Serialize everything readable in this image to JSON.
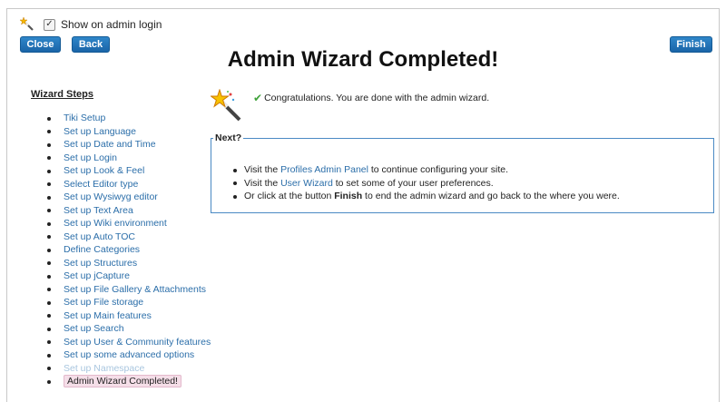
{
  "header": {
    "show_on_login_label": "Show on admin login",
    "show_on_login_checked": true,
    "close_label": "Close",
    "back_label": "Back",
    "finish_label": "Finish",
    "title": "Admin Wizard Completed!"
  },
  "sidebar": {
    "heading": "Wizard Steps",
    "items": [
      {
        "label": "Tiki Setup",
        "state": "link"
      },
      {
        "label": "Set up Language",
        "state": "link"
      },
      {
        "label": "Set up Date and Time",
        "state": "link"
      },
      {
        "label": "Set up Login",
        "state": "link"
      },
      {
        "label": "Set up Look & Feel",
        "state": "link"
      },
      {
        "label": "Select Editor type",
        "state": "link"
      },
      {
        "label": "Set up Wysiwyg editor",
        "state": "link"
      },
      {
        "label": "Set up Text Area",
        "state": "link"
      },
      {
        "label": "Set up Wiki environment",
        "state": "link"
      },
      {
        "label": "Set up Auto TOC",
        "state": "link"
      },
      {
        "label": "Define Categories",
        "state": "link"
      },
      {
        "label": "Set up Structures",
        "state": "link"
      },
      {
        "label": "Set up jCapture",
        "state": "link"
      },
      {
        "label": "Set up File Gallery & Attachments",
        "state": "link"
      },
      {
        "label": "Set up File storage",
        "state": "link"
      },
      {
        "label": "Set up Main features",
        "state": "link"
      },
      {
        "label": "Set up Search",
        "state": "link"
      },
      {
        "label": "Set up User & Community features",
        "state": "link"
      },
      {
        "label": "Set up some advanced options",
        "state": "link"
      },
      {
        "label": "Set up Namespace",
        "state": "disabled"
      },
      {
        "label": "Admin Wizard Completed!",
        "state": "current"
      }
    ]
  },
  "main": {
    "congrats_text": "Congratulations. You are done with the admin wizard.",
    "next_legend": "Next?",
    "next_items": [
      {
        "before": "Visit the ",
        "link": "Profiles Admin Panel",
        "after": " to continue configuring your site."
      },
      {
        "before": "Visit the ",
        "link": "User Wizard",
        "after": " to set some of your user preferences."
      },
      {
        "before": "Or click at the button ",
        "bold": "Finish",
        "after": " to end the admin wizard and go back to the where you were."
      }
    ]
  },
  "colors": {
    "button_blue": "#1f6fb5",
    "link_blue": "#2b6ea9",
    "disabled_link": "#a9c6df",
    "current_highlight": "#f5dee8",
    "fieldset_border": "#4a8ac4",
    "check_green": "#3fa23a"
  },
  "icons": {
    "wand_small": "magic-wand-icon",
    "wand_big": "magic-wand-icon",
    "checkmark": "checkmark-icon"
  }
}
